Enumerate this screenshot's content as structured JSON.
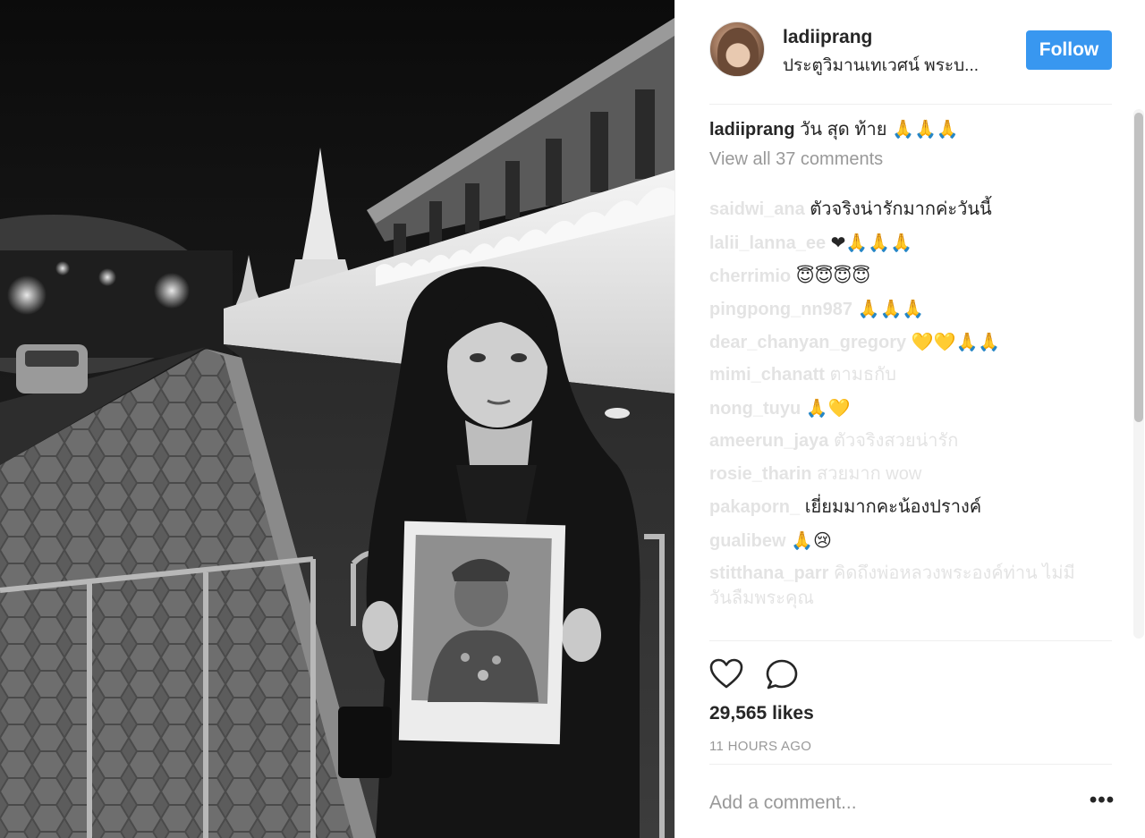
{
  "post": {
    "username": "ladiiprang",
    "location": "ประตูวิมานเทเวศน์ พระบ...",
    "follow_label": "Follow",
    "caption_user": "ladiiprang",
    "caption_text": "วัน สุด ท้าย",
    "caption_emoji": "🙏🙏🙏",
    "view_all": "View all 37 comments",
    "likes": "29,565 likes",
    "time": "11 HOURS AGO",
    "comment_placeholder": "Add a comment...",
    "more": "•••"
  },
  "comments": [
    {
      "user": "saidwi_ana",
      "text": "ตัวจริงน่ารักมากค่ะวันนี้",
      "emoji": ""
    },
    {
      "user": "lalii_lanna_ee",
      "text": "",
      "emoji": "❤🙏🙏🙏"
    },
    {
      "user": "cherrimio",
      "text": "",
      "emoji": "😇😇😇😇"
    },
    {
      "user": "pingpong_nn987",
      "text": "",
      "emoji": "🙏🙏🙏"
    },
    {
      "user": "dear_chanyan_gregory",
      "text": "",
      "emoji": "💛💛🙏🙏"
    },
    {
      "user": "mimi_chanatt",
      "text": "ตามธกับ",
      "emoji": ""
    },
    {
      "user": "nong_tuyu",
      "text": "",
      "emoji": "🙏💛"
    },
    {
      "user": "ameerun_jaya",
      "text": "ตัวจริงสวยน่ารัก",
      "emoji": ""
    },
    {
      "user": "rosie_tharin",
      "text": "สวยมาก wow",
      "emoji": ""
    },
    {
      "user": "pakaporn_",
      "text": "เยี่ยมมากคะน้องปรางค์",
      "emoji": ""
    },
    {
      "user": "gualibew",
      "text": "",
      "emoji": "🙏😢"
    },
    {
      "user": "stitthana_parr",
      "text": "คิดถึงพ่อหลวงพระองค์ท่าน ไม่มีวันลืมพระคุณ",
      "emoji": ""
    }
  ],
  "icons": {
    "like": "heart-outline-icon",
    "comment": "speech-bubble-icon",
    "more": "ellipsis-icon"
  },
  "colors": {
    "follow": "#3897f0",
    "muted": "#999999",
    "text": "#262626"
  }
}
